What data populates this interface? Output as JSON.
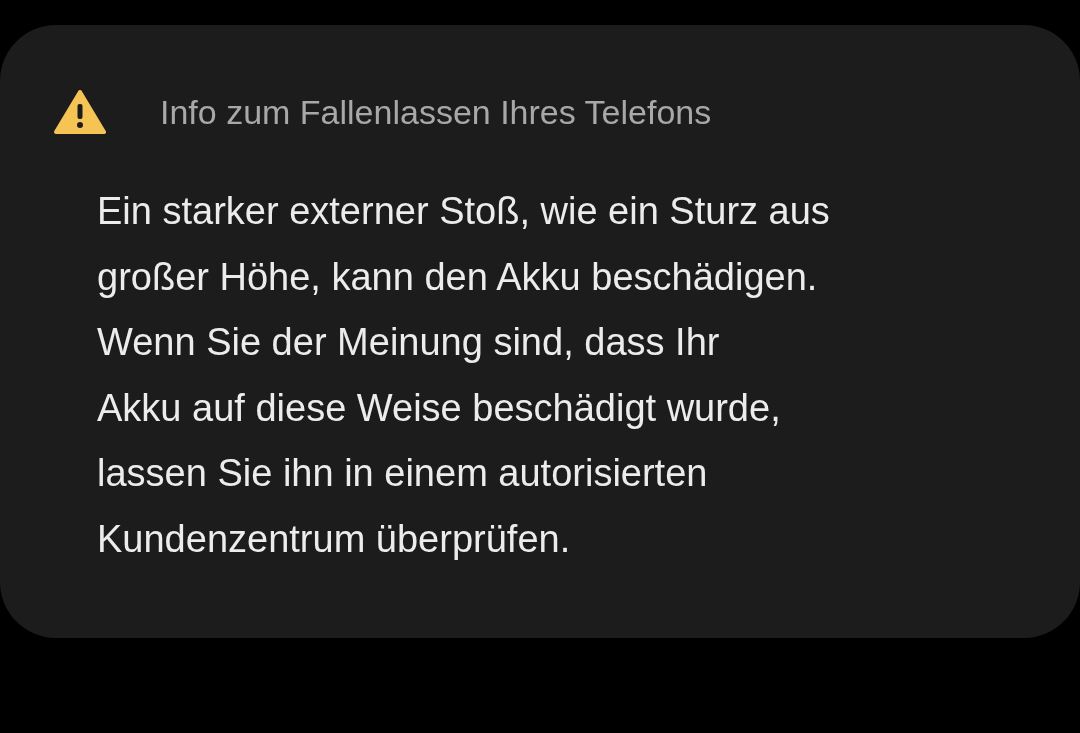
{
  "dialog": {
    "title": "Info zum Fallenlassen Ihres Telefons",
    "message": "Ein starker externer Stoß, wie ein Sturz aus\ngroßer Höhe, kann den Akku beschädigen.\nWenn Sie der Meinung sind, dass Ihr\nAkku auf diese Weise beschädigt wurde,\nlassen Sie ihn in einem autorisierten\nKundenzentrum überprüfen."
  }
}
